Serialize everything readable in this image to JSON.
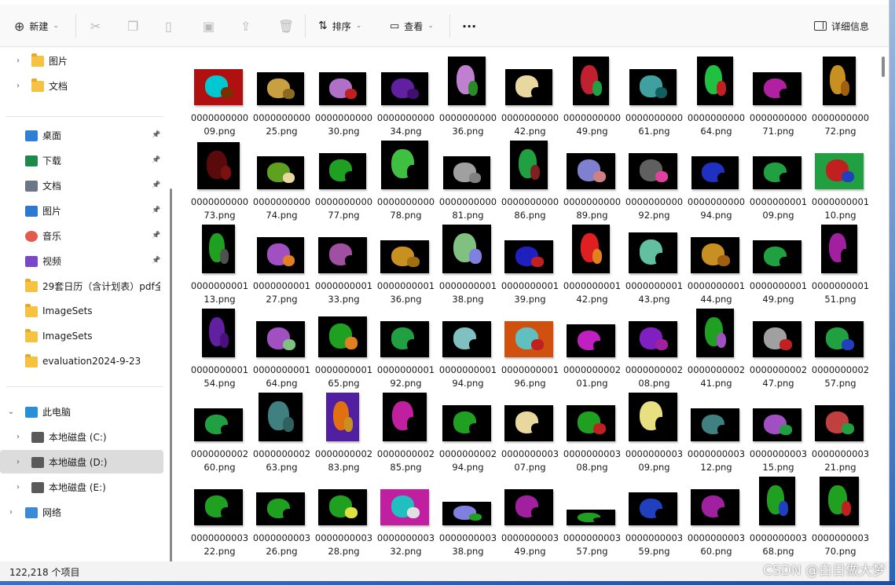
{
  "toolbar": {
    "new_label": "新建",
    "sort_label": "排序",
    "view_label": "查看",
    "more_label": "···",
    "details_label": "详细信息"
  },
  "sidebar": {
    "quick_folders": [
      {
        "label": "图片"
      },
      {
        "label": "文档"
      }
    ],
    "pinned": [
      {
        "label": "桌面",
        "icon": "desktop-icon",
        "color": "#2f7fd6"
      },
      {
        "label": "下载",
        "icon": "download-icon",
        "color": "#1d8a4c"
      },
      {
        "label": "文档",
        "icon": "document-icon",
        "color": "#6b7785"
      },
      {
        "label": "图片",
        "icon": "pictures-icon",
        "color": "#2d79d0"
      },
      {
        "label": "音乐",
        "icon": "music-icon",
        "color": "#e25b4b"
      },
      {
        "label": "视频",
        "icon": "video-icon",
        "color": "#7b47c6"
      }
    ],
    "folders": [
      {
        "label": "29套日历（含计划表）pdf全"
      },
      {
        "label": "ImageSets"
      },
      {
        "label": "ImageSets"
      },
      {
        "label": "evaluation2024-9-23"
      }
    ],
    "this_pc": "此电脑",
    "drives": [
      {
        "label": "本地磁盘 (C:)"
      },
      {
        "label": "本地磁盘 (D:)"
      },
      {
        "label": "本地磁盘 (E:)"
      }
    ],
    "network": "网络"
  },
  "files": [
    {
      "name": "000000000009.png",
      "w": 62,
      "h": 46,
      "bg": "#b01010",
      "c1": "#00c8d0",
      "c2": "#7a3000"
    },
    {
      "name": "000000000025.png",
      "w": 60,
      "h": 42,
      "bg": "#000000",
      "c1": "#c8a040",
      "c2": "#8a6a20"
    },
    {
      "name": "000000000030.png",
      "w": 60,
      "h": 42,
      "bg": "#000000",
      "c1": "#b070c8",
      "c2": "#c02020"
    },
    {
      "name": "000000000034.png",
      "w": 60,
      "h": 42,
      "bg": "#000000",
      "c1": "#6020a0",
      "c2": "#401070"
    },
    {
      "name": "000000000036.png",
      "w": 48,
      "h": 62,
      "bg": "#000000",
      "c1": "#c080d0",
      "c2": "#2a8a2a"
    },
    {
      "name": "000000000042.png",
      "w": 60,
      "h": 46,
      "bg": "#000000",
      "c1": "#e8d8a0",
      "c2": "#000000"
    },
    {
      "name": "000000000049.png",
      "w": 46,
      "h": 62,
      "bg": "#000000",
      "c1": "#c02030",
      "c2": "#20a040"
    },
    {
      "name": "000000000061.png",
      "w": 60,
      "h": 46,
      "bg": "#000000",
      "c1": "#40a0a0",
      "c2": "#106060"
    },
    {
      "name": "000000000064.png",
      "w": 46,
      "h": 62,
      "bg": "#000000",
      "c1": "#20c040",
      "c2": "#c02020"
    },
    {
      "name": "000000000071.png",
      "w": 62,
      "h": 42,
      "bg": "#000000",
      "c1": "#b020a0",
      "c2": "#000000"
    },
    {
      "name": "000000000072.png",
      "w": 42,
      "h": 62,
      "bg": "#000000",
      "c1": "#c89020",
      "c2": "#a06010"
    },
    {
      "name": "000000000073.png",
      "w": 54,
      "h": 60,
      "bg": "#000000",
      "c1": "#5a0a0a",
      "c2": "#7a1010"
    },
    {
      "name": "000000000074.png",
      "w": 60,
      "h": 42,
      "bg": "#000000",
      "c1": "#60a020",
      "c2": "#e8d8a0"
    },
    {
      "name": "000000000077.png",
      "w": 60,
      "h": 46,
      "bg": "#000000",
      "c1": "#20a020",
      "c2": "#000000"
    },
    {
      "name": "000000000078.png",
      "w": 60,
      "h": 62,
      "bg": "#000000",
      "c1": "#40c040",
      "c2": "#000000"
    },
    {
      "name": "000000000081.png",
      "w": 60,
      "h": 42,
      "bg": "#000000",
      "c1": "#a0a0a0",
      "c2": "#808080"
    },
    {
      "name": "000000000086.png",
      "w": 48,
      "h": 62,
      "bg": "#000000",
      "c1": "#20a040",
      "c2": "#802020"
    },
    {
      "name": "000000000089.png",
      "w": 62,
      "h": 46,
      "bg": "#000000",
      "c1": "#8080d0",
      "c2": "#d08080"
    },
    {
      "name": "000000000092.png",
      "w": 62,
      "h": 46,
      "bg": "#000000",
      "c1": "#606060",
      "c2": "#e040a0"
    },
    {
      "name": "000000000094.png",
      "w": 60,
      "h": 42,
      "bg": "#000000",
      "c1": "#2030c0",
      "c2": "#000000"
    },
    {
      "name": "000000000109.png",
      "w": 62,
      "h": 42,
      "bg": "#000000",
      "c1": "#20a040",
      "c2": "#000000"
    },
    {
      "name": "000000000110.png",
      "w": 62,
      "h": 46,
      "bg": "#20a040",
      "c1": "#c02020",
      "c2": "#2040c0"
    },
    {
      "name": "000000000113.png",
      "w": 42,
      "h": 62,
      "bg": "#000000",
      "c1": "#20a020",
      "c2": "#505050"
    },
    {
      "name": "000000000127.png",
      "w": 60,
      "h": 46,
      "bg": "#000000",
      "c1": "#a050c0",
      "c2": "#e08020"
    },
    {
      "name": "000000000133.png",
      "w": 62,
      "h": 46,
      "bg": "#000000",
      "c1": "#a050a0",
      "c2": "#000000"
    },
    {
      "name": "000000000136.png",
      "w": 62,
      "h": 42,
      "bg": "#000000",
      "c1": "#c89020",
      "c2": "#a07010"
    },
    {
      "name": "000000000138.png",
      "w": 62,
      "h": 62,
      "bg": "#000000",
      "c1": "#80c080",
      "c2": "#8080e0"
    },
    {
      "name": "000000000139.png",
      "w": 62,
      "h": 42,
      "bg": "#000000",
      "c1": "#2020c0",
      "c2": "#c02020"
    },
    {
      "name": "000000000142.png",
      "w": 48,
      "h": 62,
      "bg": "#000000",
      "c1": "#e02020",
      "c2": "#e08020"
    },
    {
      "name": "000000000143.png",
      "w": 62,
      "h": 52,
      "bg": "#000000",
      "c1": "#60c0a0",
      "c2": "#000000"
    },
    {
      "name": "000000000144.png",
      "w": 62,
      "h": 46,
      "bg": "#000000",
      "c1": "#c89020",
      "c2": "#a06010"
    },
    {
      "name": "000000000149.png",
      "w": 62,
      "h": 42,
      "bg": "#000000",
      "c1": "#20a040",
      "c2": "#000000"
    },
    {
      "name": "000000000151.png",
      "w": 46,
      "h": 62,
      "bg": "#000000",
      "c1": "#a020a0",
      "c2": "#000000"
    },
    {
      "name": "000000000154.png",
      "w": 42,
      "h": 62,
      "bg": "#000000",
      "c1": "#6020a0",
      "c2": "#4a1080"
    },
    {
      "name": "000000000164.png",
      "w": 62,
      "h": 46,
      "bg": "#000000",
      "c1": "#a050c0",
      "c2": "#80c080"
    },
    {
      "name": "000000000165.png",
      "w": 62,
      "h": 52,
      "bg": "#000000",
      "c1": "#20a020",
      "c2": "#e08020"
    },
    {
      "name": "000000000192.png",
      "w": 62,
      "h": 46,
      "bg": "#000000",
      "c1": "#20a040",
      "c2": "#000000"
    },
    {
      "name": "000000000194.png",
      "w": 62,
      "h": 46,
      "bg": "#000000",
      "c1": "#80c0c0",
      "c2": "#000000"
    },
    {
      "name": "000000000196.png",
      "w": 62,
      "h": 46,
      "bg": "#d05010",
      "c1": "#60c0c0",
      "c2": "#c02020"
    },
    {
      "name": "000000000201.png",
      "w": 62,
      "h": 42,
      "bg": "#000000",
      "c1": "#c020c0",
      "c2": "#000000"
    },
    {
      "name": "000000000208.png",
      "w": 62,
      "h": 46,
      "bg": "#000000",
      "c1": "#8020c0",
      "c2": "#a020a0"
    },
    {
      "name": "000000000241.png",
      "w": 48,
      "h": 62,
      "bg": "#000000",
      "c1": "#20a020",
      "c2": "#a050c0"
    },
    {
      "name": "000000000247.png",
      "w": 62,
      "h": 46,
      "bg": "#000000",
      "c1": "#a0a0a0",
      "c2": "#c02020"
    },
    {
      "name": "000000000257.png",
      "w": 62,
      "h": 46,
      "bg": "#000000",
      "c1": "#20a040",
      "c2": "#2040c0"
    },
    {
      "name": "000000000260.png",
      "w": 62,
      "h": 42,
      "bg": "#000000",
      "c1": "#20a040",
      "c2": "#000000"
    },
    {
      "name": "000000000263.png",
      "w": 56,
      "h": 62,
      "bg": "#000000",
      "c1": "#408080",
      "c2": "#306060"
    },
    {
      "name": "000000000283.png",
      "w": 42,
      "h": 62,
      "bg": "#5020a0",
      "c1": "#e07010",
      "c2": "#c89020"
    },
    {
      "name": "000000000285.png",
      "w": 56,
      "h": 62,
      "bg": "#000000",
      "c1": "#c020a0",
      "c2": "#000000"
    },
    {
      "name": "000000000294.png",
      "w": 62,
      "h": 46,
      "bg": "#000000",
      "c1": "#20a020",
      "c2": "#000000"
    },
    {
      "name": "000000000307.png",
      "w": 62,
      "h": 46,
      "bg": "#000000",
      "c1": "#e8d8a0",
      "c2": "#000000"
    },
    {
      "name": "000000000308.png",
      "w": 62,
      "h": 46,
      "bg": "#000000",
      "c1": "#20a020",
      "c2": "#c02020"
    },
    {
      "name": "000000000309.png",
      "w": 62,
      "h": 62,
      "bg": "#000000",
      "c1": "#e8e080",
      "c2": "#000000"
    },
    {
      "name": "000000000312.png",
      "w": 62,
      "h": 42,
      "bg": "#000000",
      "c1": "#408080",
      "c2": "#000000"
    },
    {
      "name": "000000000315.png",
      "w": 62,
      "h": 42,
      "bg": "#000000",
      "c1": "#a050c0",
      "c2": "#20a040"
    },
    {
      "name": "000000000321.png",
      "w": 62,
      "h": 46,
      "bg": "#000000",
      "c1": "#c04040",
      "c2": "#20a040"
    },
    {
      "name": "000000000322.png",
      "w": 62,
      "h": 46,
      "bg": "#000000",
      "c1": "#20a020",
      "c2": "#000000"
    },
    {
      "name": "000000000326.png",
      "w": 62,
      "h": 42,
      "bg": "#000000",
      "c1": "#20a020",
      "c2": "#000000"
    },
    {
      "name": "000000000328.png",
      "w": 62,
      "h": 46,
      "bg": "#000000",
      "c1": "#20a020",
      "c2": "#e0e040"
    },
    {
      "name": "000000000332.png",
      "w": 62,
      "h": 46,
      "bg": "#c020a0",
      "c1": "#20c0c0",
      "c2": "#e0e0e0"
    },
    {
      "name": "000000000338.png",
      "w": 62,
      "h": 30,
      "bg": "#000000",
      "c1": "#8080e0",
      "c2": "#20a020"
    },
    {
      "name": "000000000349.png",
      "w": 62,
      "h": 46,
      "bg": "#000000",
      "c1": "#a020a0",
      "c2": "#000000"
    },
    {
      "name": "000000000357.png",
      "w": 62,
      "h": 20,
      "bg": "#000000",
      "c1": "#20a020",
      "c2": "#000000"
    },
    {
      "name": "000000000359.png",
      "w": 62,
      "h": 42,
      "bg": "#000000",
      "c1": "#2040c0",
      "c2": "#000000"
    },
    {
      "name": "000000000360.png",
      "w": 62,
      "h": 46,
      "bg": "#000000",
      "c1": "#a020a0",
      "c2": "#000000"
    },
    {
      "name": "000000000368.png",
      "w": 46,
      "h": 62,
      "bg": "#000000",
      "c1": "#20a020",
      "c2": "#2040c0"
    },
    {
      "name": "000000000370.png",
      "w": 50,
      "h": 62,
      "bg": "#000000",
      "c1": "#20a020",
      "c2": "#c02020"
    }
  ],
  "status": {
    "item_count": "122,218 个项目"
  },
  "watermark": "CSDN @白日做大梦"
}
